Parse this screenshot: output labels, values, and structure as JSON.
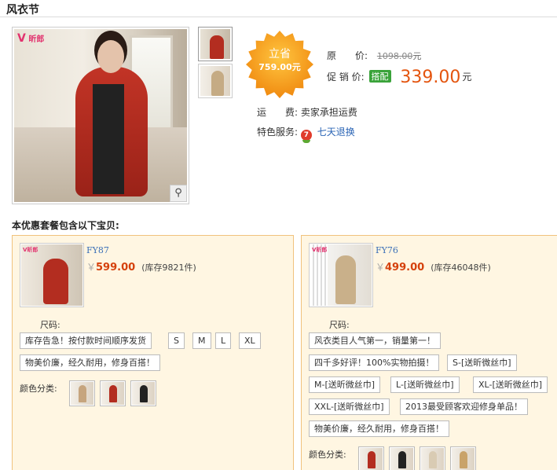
{
  "page": {
    "title": "风衣节"
  },
  "product": {
    "brand_logo": "昕郎",
    "zoom_icon": "magnifier-icon",
    "thumbs": [
      "red-trench-thumb",
      "beige-trench-thumb"
    ],
    "badge": {
      "top": "立省",
      "value": "759.00元",
      "color": "#f4a21a"
    },
    "original_label": "原　　价:",
    "original_price": "1098.00",
    "original_unit": "元",
    "promo_label": "促 销 价:",
    "promo_tag": "搭配",
    "promo_price": "339.00",
    "promo_unit": "元",
    "shipping_label": "运　　费:",
    "shipping_value": "卖家承担运费",
    "service_label": "特色服务:",
    "service_icon_text": "7",
    "service_link": "七天退换"
  },
  "section_title": "本优惠套餐包含以下宝贝:",
  "packages": [
    {
      "code": "FY87",
      "currency": "￥",
      "price": "599.00",
      "stock": "(库存9821件)",
      "size_label": "尺码:",
      "options": [
        "库存告急！按付款时间顺序发货",
        "S",
        "M",
        "L",
        "XL",
        "物美价廉，经久耐用，修身百搭！"
      ],
      "color_label": "颜色分类:",
      "swatches": [
        "#c6a57e",
        "#b32d20",
        "#222222"
      ]
    },
    {
      "code": "FY76",
      "currency": "￥",
      "price": "499.00",
      "stock": "(库存46048件)",
      "size_label": "尺码:",
      "options": [
        "风衣类目人气第一，销量第一！",
        "四千多好评！100%实物拍摄！",
        "S-[送昕微丝巾]",
        "M-[送昕微丝巾]",
        "L-[送昕微丝巾]",
        "XL-[送昕微丝巾]",
        "XXL-[送昕微丝巾]",
        "2013最受顾客欢迎修身单品！",
        "物美价廉，经久耐用，修身百搭！"
      ],
      "color_label": "颜色分类:",
      "swatches": [
        "#b32d20",
        "#222222",
        "#d9cbb3",
        "#c9a36a"
      ]
    }
  ],
  "colors": {
    "accent": "#e4550f",
    "package_bg": "#fff6e2",
    "package_border": "#f1c27d",
    "link": "#2a64b5"
  }
}
